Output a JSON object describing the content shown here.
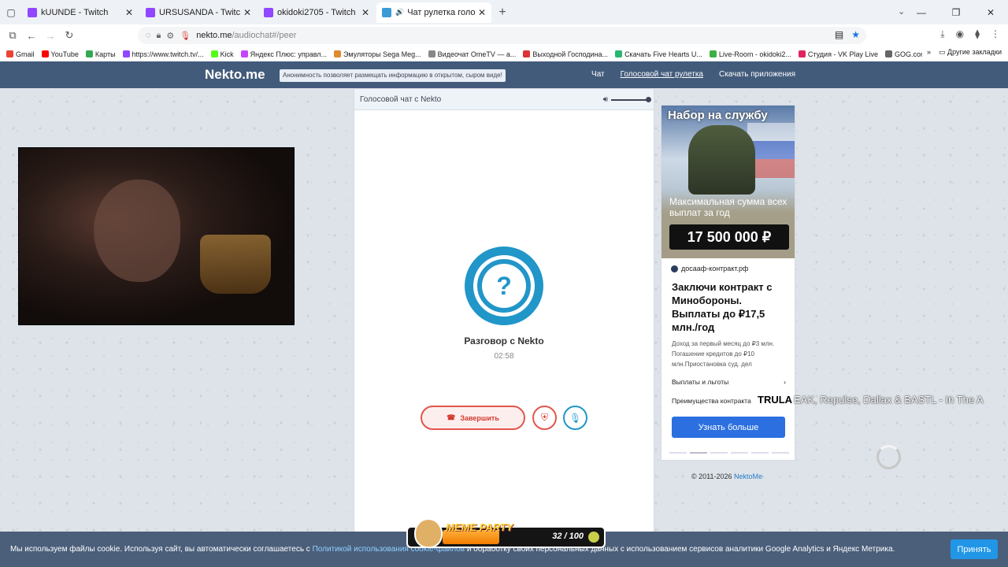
{
  "browser": {
    "tabs": [
      {
        "title": "kUUNDE - Twitch",
        "favicon": "twitch-icon",
        "active": false
      },
      {
        "title": "URSUSANDA - Twitch",
        "favicon": "twitch-icon",
        "active": false
      },
      {
        "title": "okidoki2705 - Twitch",
        "favicon": "twitch-icon",
        "active": false
      },
      {
        "title": "Чат рулетка голосовая — ...",
        "favicon": "nekto-icon",
        "active": true
      }
    ],
    "url_host": "nekto.me",
    "url_path": "/audiochat#/peer",
    "bookmarks": [
      "Gmail",
      "YouTube",
      "Карты",
      "https://www.twitch.tv/...",
      "Kick",
      "Яндекс Плюс: управл...",
      "Эмуляторы Sega Meg...",
      "Видеочат OmeTV — а...",
      "Выходной Господина...",
      "Скачать Five Hearts U...",
      "Live-Room - okidoki2...",
      "Студия - VK Play Live",
      "GOG.com"
    ],
    "other_bookmarks": "Другие закладки"
  },
  "site": {
    "logo": "Nekto.me",
    "anon_note": "Анонимность позволяет размещать информацию в открытом, сыром виде!",
    "nav": [
      "Чат",
      "Голосовой чат рулетка",
      "Скачать приложения"
    ],
    "chat_header": "Голосовой чат с Nekto",
    "volume_level": 1.0,
    "peer_name": "Разговор с Nekto",
    "timer": "02:58",
    "end_label": "Завершить",
    "copyright": "© 2011-2026",
    "copyright_link": "NektoMe"
  },
  "ad": {
    "title": "Набор на службу",
    "subtitle": "Максимальная сумма всех выплат за год",
    "amount": "17 500 000 ₽",
    "site": "досааф-контракт.рф",
    "headline": "Заключи контракт с Минобороны. Выплаты до ₽17,5 млн./год",
    "text": "Доход за первый месяц до ₽3 млн. Погашение кредитов до ₽10 млн.Приостановка суд. дел",
    "link1": "Выплаты и льготы",
    "link2": "Преимущества контракта",
    "button": "Узнать больше"
  },
  "overlay": {
    "now_playing_tag": "TRULA",
    "now_playing": "EAK, Repulse, Dallax & BASTL - In The A",
    "meme_label": "MEME PARTY",
    "meme_count": "32 / 100",
    "meme_progress": 0.32
  },
  "cookie": {
    "text_before": "Мы используем файлы cookie. Используя сайт, вы автоматически соглашаетесь с",
    "link": "Политикой использования cookie-файлов",
    "text_after": "и обработку своих персональных данных с использованием сервисов аналитики Google Analytics и Яндекс Метрика.",
    "accept": "Принять"
  }
}
